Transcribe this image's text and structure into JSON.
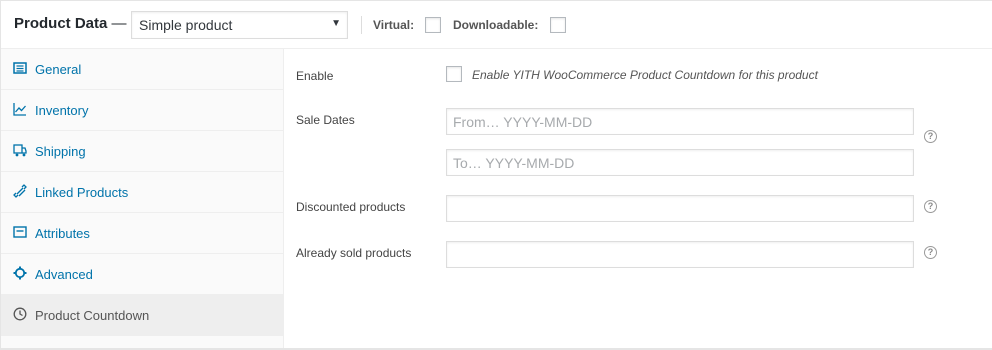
{
  "header": {
    "title": "Product Data",
    "dash": " —",
    "product_type": "Simple product",
    "virtual_label": "Virtual:",
    "downloadable_label": "Downloadable:"
  },
  "sidebar": {
    "items": [
      {
        "label": "General",
        "icon": "general-icon"
      },
      {
        "label": "Inventory",
        "icon": "inventory-icon"
      },
      {
        "label": "Shipping",
        "icon": "shipping-icon"
      },
      {
        "label": "Linked Products",
        "icon": "link-icon"
      },
      {
        "label": "Attributes",
        "icon": "attributes-icon"
      },
      {
        "label": "Advanced",
        "icon": "gear-icon"
      },
      {
        "label": "Product Countdown",
        "icon": "clock-icon",
        "active": true
      }
    ]
  },
  "form": {
    "enable_label": "Enable",
    "enable_desc": "Enable YITH WooCommerce Product Countdown for this product",
    "sale_dates_label": "Sale Dates",
    "from_placeholder": "From… YYYY-MM-DD",
    "to_placeholder": "To…  YYYY-MM-DD",
    "discounted_label": "Discounted products",
    "sold_label": "Already sold products",
    "help_glyph": "?"
  },
  "colors": {
    "link": "#0073aa",
    "active_tab_bg": "#eeeeee",
    "sidebar_bg": "#fafafa"
  }
}
